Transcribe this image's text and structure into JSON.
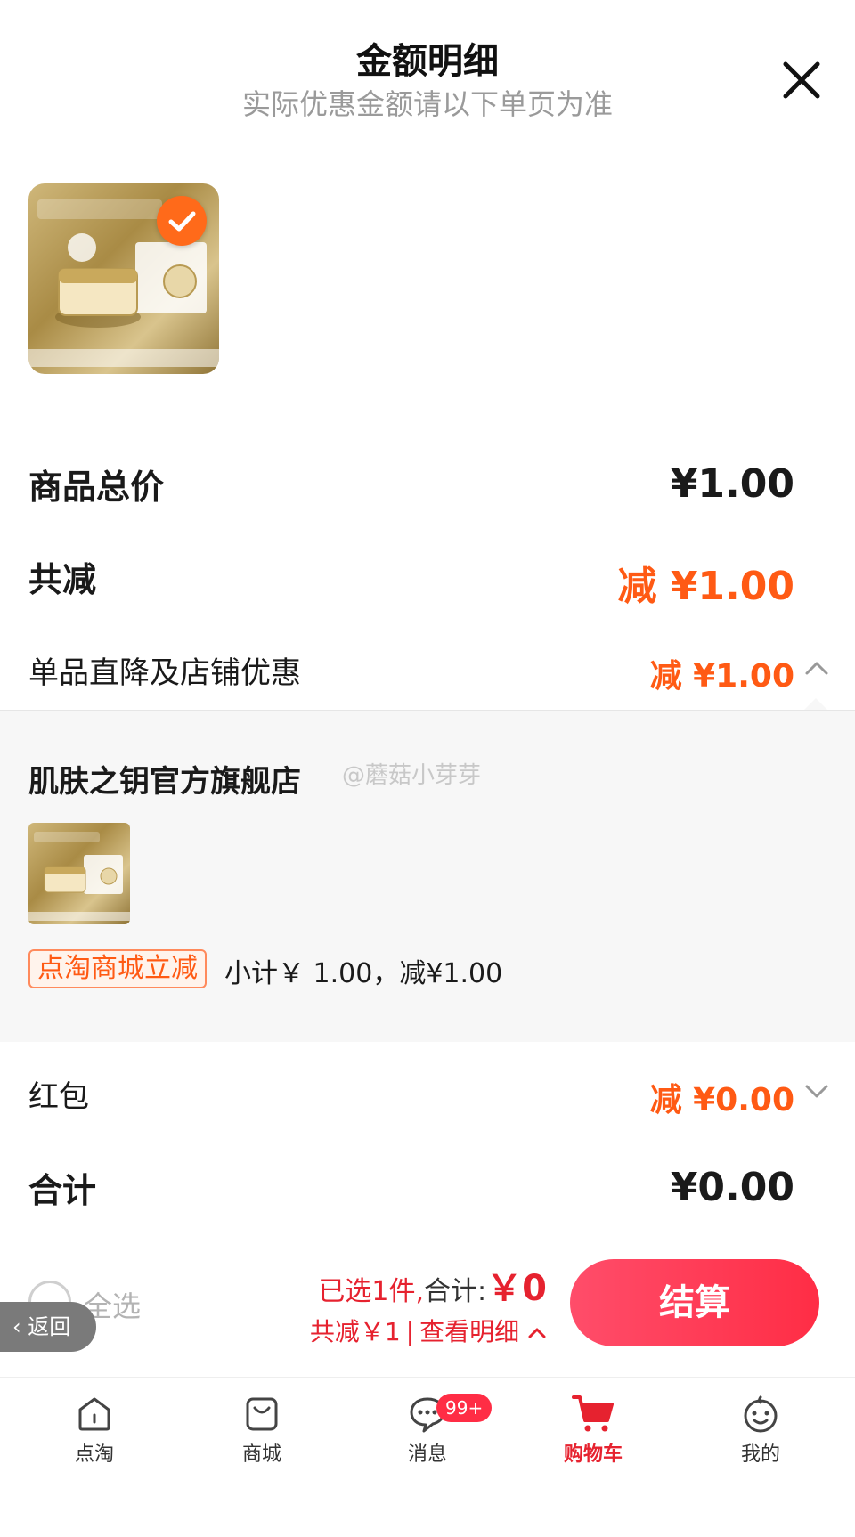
{
  "header": {
    "title": "金额明细",
    "subtitle": "实际优惠金额请以下单页为准"
  },
  "summary_rows": {
    "total_price_label": "商品总价",
    "total_price_value": "¥1.00",
    "total_discount_label": "共减",
    "total_discount_value": "减 ¥1.00",
    "item_discount_label": "单品直降及店铺优惠",
    "item_discount_value": "减 ¥1.00",
    "red_packet_label": "红包",
    "red_packet_value": "减 ¥0.00",
    "grand_total_label": "合计",
    "grand_total_value": "¥0.00"
  },
  "store": {
    "name": "肌肤之钥官方旗舰店",
    "watermark": "@蘑菇小芽芽",
    "promo_tag": "点淘商城立减",
    "promo_text": "小计￥ 1.00，减¥1.00"
  },
  "bottom_bar": {
    "select_all": "全选",
    "back": "返回",
    "selected_prefix": "已选1件,",
    "total_label": "合计:",
    "total_amount": "￥0",
    "discount_text": "共减￥1",
    "separator": "|",
    "view_detail": "查看明细",
    "checkout": "结算"
  },
  "tabs": [
    {
      "label": "点淘",
      "icon": "home-icon"
    },
    {
      "label": "商城",
      "icon": "bag-icon"
    },
    {
      "label": "消息",
      "icon": "message-icon",
      "badge": "99+"
    },
    {
      "label": "购物车",
      "icon": "cart-icon",
      "active": true
    },
    {
      "label": "我的",
      "icon": "profile-icon"
    }
  ],
  "colors": {
    "accent_orange": "#ff5a14",
    "accent_red": "#e6222f",
    "checkout_gradient_start": "#ff4d6a",
    "checkout_gradient_end": "#ff2d45"
  }
}
